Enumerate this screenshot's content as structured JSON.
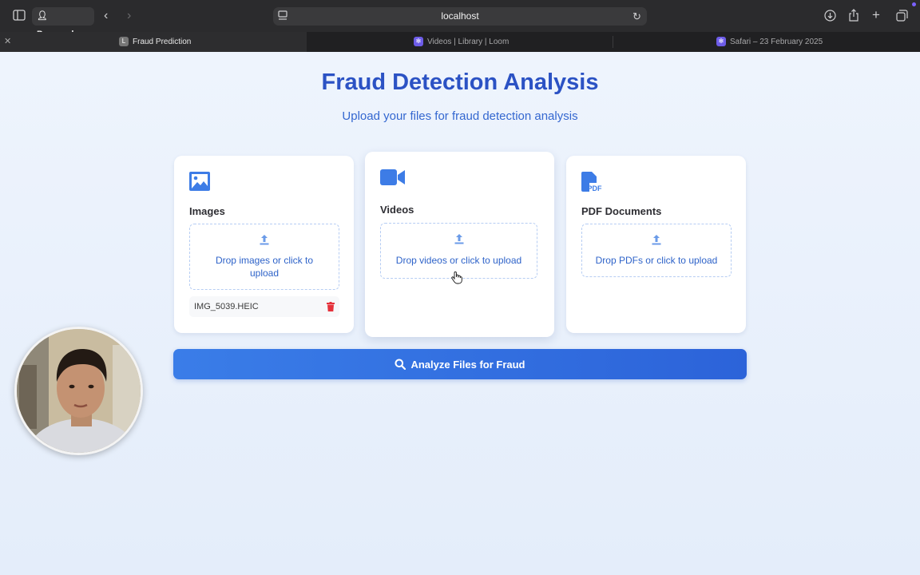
{
  "browser": {
    "profile_label": "Personal",
    "address": "localhost",
    "tabs": [
      {
        "label": "Fraud Prediction",
        "favicon": "L"
      },
      {
        "label": "Videos | Library | Loom"
      },
      {
        "label": "Safari – 23 February 2025"
      }
    ]
  },
  "page": {
    "title": "Fraud Detection Analysis",
    "subtitle": "Upload your files for fraud detection analysis",
    "cards": {
      "images": {
        "title": "Images",
        "drop_label": "Drop images or click to upload",
        "files": [
          "IMG_5039.HEIC"
        ]
      },
      "videos": {
        "title": "Videos",
        "drop_label": "Drop videos or click to upload"
      },
      "pdfs": {
        "title": "PDF Documents",
        "drop_label": "Drop PDFs or click to upload",
        "icon_text": "PDF"
      }
    },
    "analyze_label": "Analyze Files for Fraud"
  },
  "colors": {
    "accent": "#2b52c4",
    "button": "#3a7de8",
    "delete": "#e5323b"
  }
}
